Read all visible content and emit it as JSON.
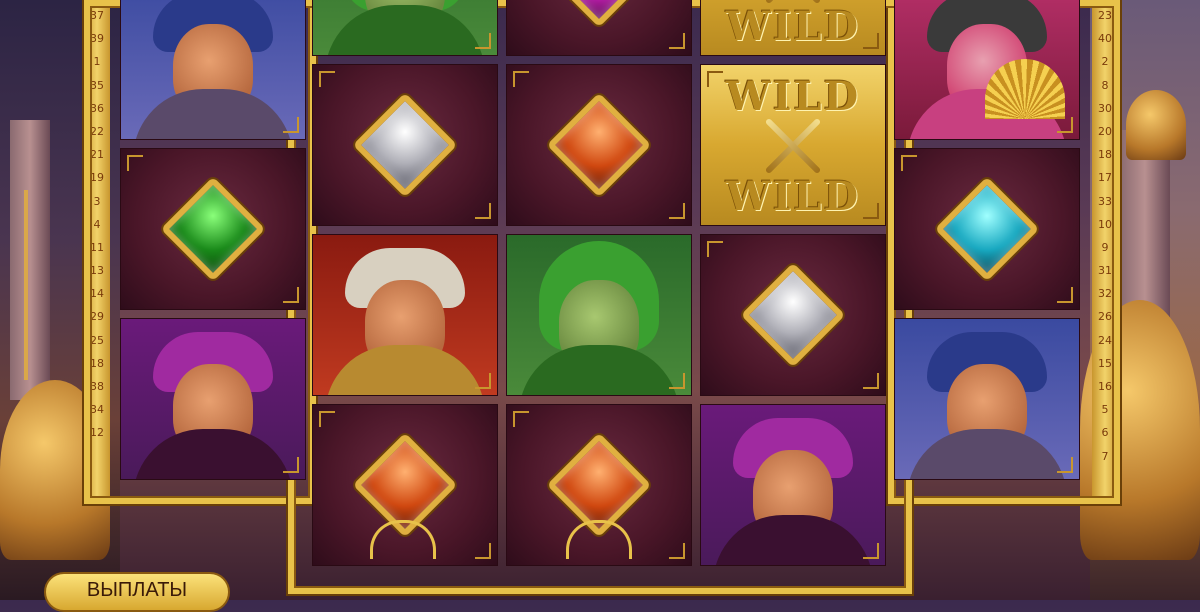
{
  "game": {
    "payouts_label": "ВЫПЛАТЫ",
    "wild_label": "WILD"
  },
  "paylines": {
    "left": [
      "37",
      "39",
      "1",
      "35",
      "36",
      "22",
      "21",
      "19",
      "3",
      "4",
      "11",
      "13",
      "14",
      "29",
      "25",
      "18",
      "38",
      "34",
      "12"
    ],
    "right": [
      "23",
      "40",
      "2",
      "8",
      "30",
      "20",
      "18",
      "17",
      "33",
      "10",
      "9",
      "31",
      "32",
      "26",
      "24",
      "15",
      "16",
      "5",
      "6",
      "7"
    ]
  },
  "reels": [
    {
      "cells": [
        {
          "type": "pirate",
          "label": ""
        },
        {
          "type": "gem",
          "color": "green"
        },
        {
          "type": "wizard",
          "label": ""
        }
      ]
    },
    {
      "cells": [
        {
          "type": "green",
          "label": ""
        },
        {
          "type": "gem",
          "color": "silver"
        },
        {
          "type": "sultan",
          "label": ""
        },
        {
          "type": "gem",
          "color": "orange"
        }
      ]
    },
    {
      "cells": [
        {
          "type": "gem",
          "color": "magenta"
        },
        {
          "type": "gem",
          "color": "orange"
        },
        {
          "type": "green",
          "label": ""
        },
        {
          "type": "gem",
          "color": "orange"
        }
      ]
    },
    {
      "cells": [
        {
          "type": "wild"
        },
        {
          "type": "wild"
        },
        {
          "type": "gem",
          "color": "silver"
        },
        {
          "type": "wizard",
          "label": ""
        }
      ]
    },
    {
      "cells": [
        {
          "type": "lady",
          "label": ""
        },
        {
          "type": "gem",
          "color": "cyan"
        },
        {
          "type": "pirate",
          "label": ""
        }
      ]
    }
  ]
}
